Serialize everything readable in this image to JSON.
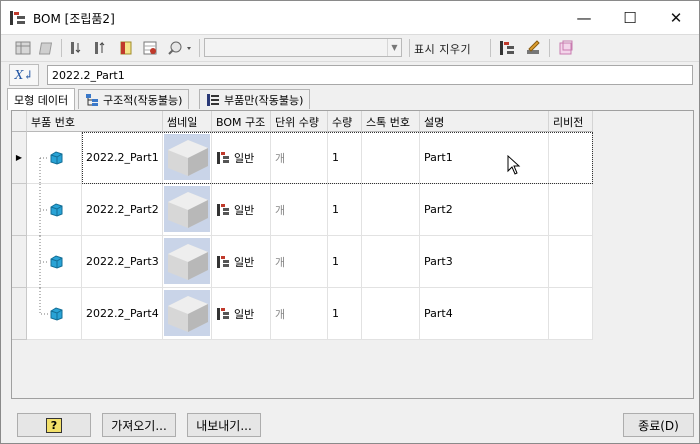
{
  "window": {
    "title": "BOM [조립품2]",
    "controls": {
      "minimize": "—",
      "maximize": "☐",
      "close": "✕"
    }
  },
  "toolbar": {
    "combo_value": "",
    "show_clear_label": "표시 지우기"
  },
  "formula": {
    "button_label": "X↲",
    "value": "2022.2_Part1"
  },
  "tabs": [
    {
      "label": "모형 데이터",
      "active": true
    },
    {
      "label": "구조적(작동불능)",
      "active": false
    },
    {
      "label": "부품만(작동불능)",
      "active": false
    }
  ],
  "grid": {
    "columns": [
      "부품 번호",
      "썸네일",
      "BOM 구조",
      "단위 수량",
      "수량",
      "스톡 번호",
      "설명",
      "리비전"
    ],
    "rows": [
      {
        "part_number": "2022.2_Part1",
        "bom": "일반",
        "unit_qty": "개",
        "qty": "1",
        "stock": "",
        "description": "Part1",
        "revision": ""
      },
      {
        "part_number": "2022.2_Part2",
        "bom": "일반",
        "unit_qty": "개",
        "qty": "1",
        "stock": "",
        "description": "Part2",
        "revision": ""
      },
      {
        "part_number": "2022.2_Part3",
        "bom": "일반",
        "unit_qty": "개",
        "qty": "1",
        "stock": "",
        "description": "Part3",
        "revision": ""
      },
      {
        "part_number": "2022.2_Part4",
        "bom": "일반",
        "unit_qty": "개",
        "qty": "1",
        "stock": "",
        "description": "Part4",
        "revision": ""
      }
    ],
    "selected_row_marker": "▶"
  },
  "footer": {
    "help_label": "?",
    "import_label": "가져오기...",
    "export_label": "내보내기...",
    "close_label": "종료(D)"
  },
  "colors": {
    "cube": "#29a3d6",
    "thumbnail_bg": "#c9d4e8",
    "window_bg": "#f0f0f0"
  }
}
